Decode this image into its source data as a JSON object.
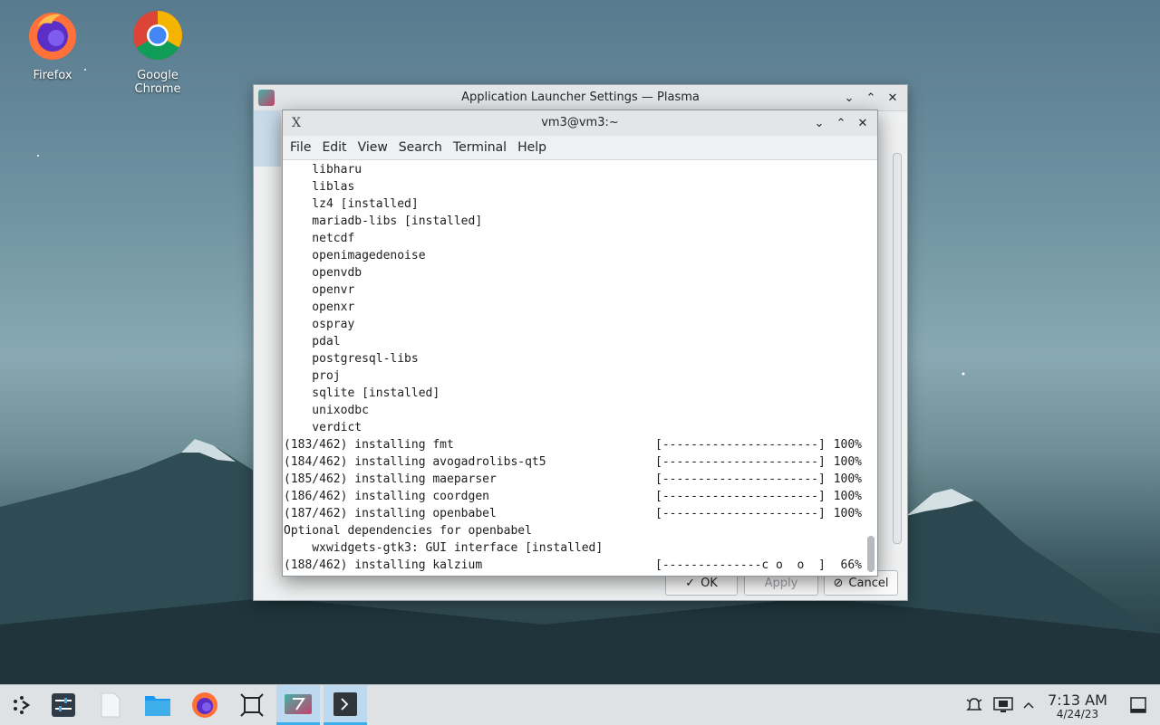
{
  "desktop": {
    "icons": [
      {
        "label": "Firefox",
        "icon": "firefox-icon"
      },
      {
        "label": "Google Chrome",
        "icon": "chrome-icon"
      }
    ]
  },
  "back_window": {
    "title": "Application Launcher Settings — Plasma",
    "ok_label": "OK",
    "apply_label": "Apply",
    "cancel_label": "Cancel"
  },
  "terminal": {
    "title": "vm3@vm3:~",
    "menu": [
      "File",
      "Edit",
      "View",
      "Search",
      "Terminal",
      "Help"
    ],
    "lines": [
      {
        "text": "    libharu"
      },
      {
        "text": "    liblas"
      },
      {
        "text": "    lz4 [installed]"
      },
      {
        "text": "    mariadb-libs [installed]"
      },
      {
        "text": "    netcdf"
      },
      {
        "text": "    openimagedenoise"
      },
      {
        "text": "    openvdb"
      },
      {
        "text": "    openvr"
      },
      {
        "text": "    openxr"
      },
      {
        "text": "    ospray"
      },
      {
        "text": "    pdal"
      },
      {
        "text": "    postgresql-libs"
      },
      {
        "text": "    proj"
      },
      {
        "text": "    sqlite [installed]"
      },
      {
        "text": "    unixodbc"
      },
      {
        "text": "    verdict"
      },
      {
        "text": "(183/462) installing fmt",
        "bar": "[----------------------]",
        "pct": "100%"
      },
      {
        "text": "(184/462) installing avogadrolibs-qt5",
        "bar": "[----------------------]",
        "pct": "100%"
      },
      {
        "text": "(185/462) installing maeparser",
        "bar": "[----------------------]",
        "pct": "100%"
      },
      {
        "text": "(186/462) installing coordgen",
        "bar": "[----------------------]",
        "pct": "100%"
      },
      {
        "text": "(187/462) installing openbabel",
        "bar": "[----------------------]",
        "pct": "100%"
      },
      {
        "text": "Optional dependencies for openbabel"
      },
      {
        "text": "    wxwidgets-gtk3: GUI interface [installed]"
      },
      {
        "text": "(188/462) installing kalzium",
        "bar": "[--------------c o  o  ]",
        "pct": "66%"
      }
    ]
  },
  "taskbar": {
    "items": [
      "launcher-icon",
      "system-settings-icon",
      "blank-document-icon",
      "file-manager-icon",
      "firefox-icon",
      "window-overview-icon",
      "plasma-settings-icon",
      "terminal-icon"
    ],
    "tray": [
      "notifications-icon",
      "display-icon",
      "tray-expand-icon"
    ],
    "time": "7:13 AM",
    "date": "4/24/23"
  },
  "colors": {
    "accent": "#3daee9",
    "terminal_bg": "#ffffff",
    "titlebar": "#e3e5e7"
  }
}
